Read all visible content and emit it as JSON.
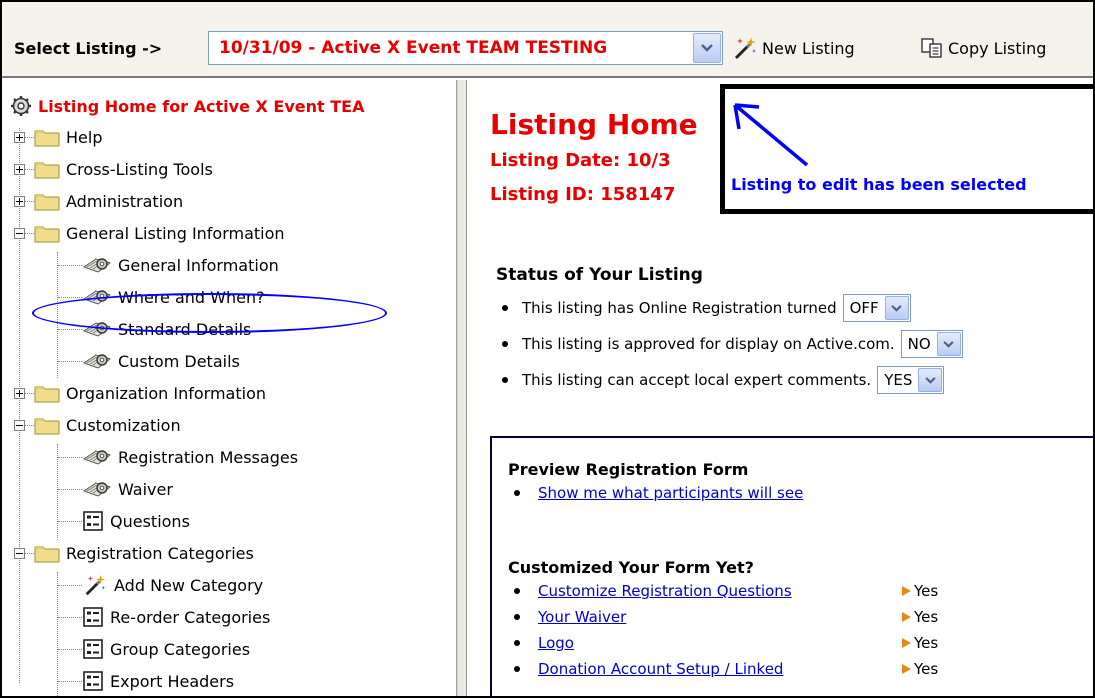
{
  "toolbar": {
    "select_label": "Select Listing ->",
    "selected_listing": "10/31/09 - Active X Event TEAM TESTING",
    "new_listing": "New Listing",
    "copy_listing": "Copy Listing"
  },
  "tree": {
    "root": "Listing Home for Active X Event TEA",
    "items": [
      {
        "label": "Help",
        "icon": "folder-icon",
        "expander": "plus"
      },
      {
        "label": "Cross-Listing Tools",
        "icon": "folder-icon",
        "expander": "plus"
      },
      {
        "label": "Administration",
        "icon": "folder-icon",
        "expander": "plus"
      },
      {
        "label": "General Listing Information",
        "icon": "folder-icon",
        "expander": "minus"
      },
      {
        "label": "General Information",
        "icon": "gear-document-icon"
      },
      {
        "label": "Where and When?",
        "icon": "gear-document-icon"
      },
      {
        "label": "Standard Details",
        "icon": "gear-document-icon"
      },
      {
        "label": "Custom Details",
        "icon": "gear-document-icon"
      },
      {
        "label": "Organization Information",
        "icon": "folder-icon",
        "expander": "plus"
      },
      {
        "label": "Customization",
        "icon": "folder-icon",
        "expander": "minus"
      },
      {
        "label": "Registration Messages",
        "icon": "gear-document-icon"
      },
      {
        "label": "Waiver",
        "icon": "gear-document-icon"
      },
      {
        "label": "Questions",
        "icon": "form-icon"
      },
      {
        "label": "Registration Categories",
        "icon": "folder-icon",
        "expander": "minus"
      },
      {
        "label": "Add New Category",
        "icon": "magic-wand-icon"
      },
      {
        "label": "Re-order Categories",
        "icon": "form-icon"
      },
      {
        "label": "Group Categories",
        "icon": "form-icon"
      },
      {
        "label": "Export Headers",
        "icon": "form-icon"
      }
    ]
  },
  "main": {
    "title": "Listing Home",
    "date_line": "Listing Date: 10/3",
    "id_line": "Listing ID: 158147",
    "callout_text": "Listing to edit has been selected",
    "status": {
      "title": "Status of Your Listing",
      "rows": [
        {
          "text": "This listing has Online Registration turned",
          "value": "OFF"
        },
        {
          "text": "This listing is approved for display on Active.com.",
          "value": "NO"
        },
        {
          "text": "This listing can accept local expert comments.",
          "value": "YES"
        }
      ]
    },
    "preview": {
      "title": "Preview Registration Form",
      "link": "Show me what participants will see",
      "custom_title": "Customized Your Form Yet?",
      "items": [
        {
          "label": "Customize Registration Questions",
          "status": "Yes"
        },
        {
          "label": "Your Waiver",
          "status": "Yes"
        },
        {
          "label": "Logo",
          "status": "Yes"
        },
        {
          "label": "Donation Account Setup / Linked",
          "status": "Yes"
        }
      ]
    }
  },
  "colors": {
    "accent_red": "#e60000",
    "link_blue": "#0000cc",
    "annotation_blue": "#0000ff",
    "status_arrow": "#e8861a"
  }
}
